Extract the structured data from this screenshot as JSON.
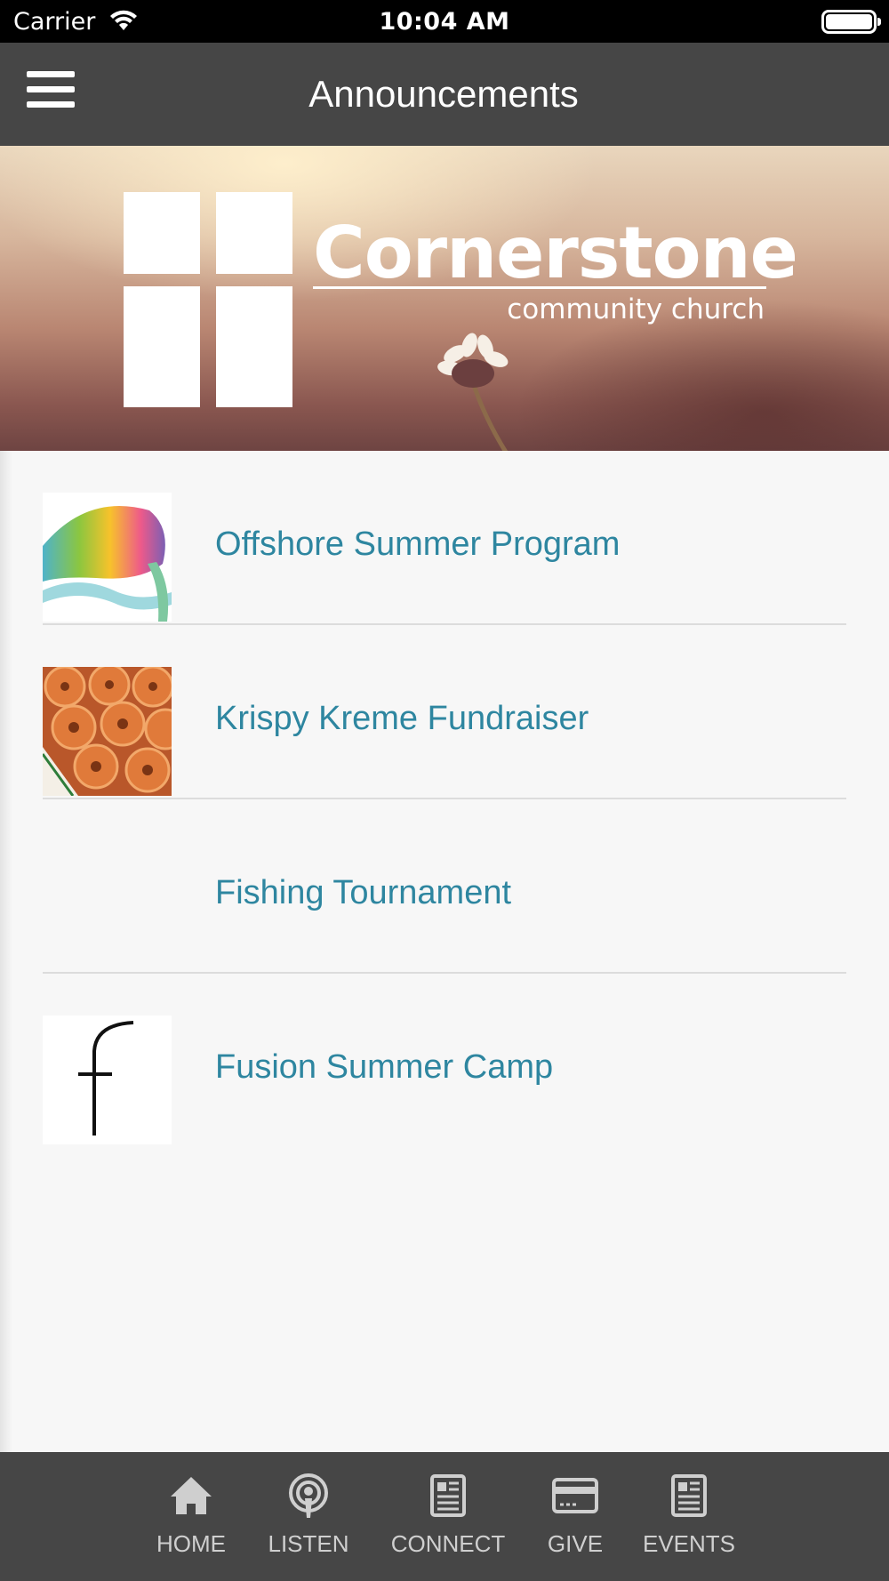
{
  "status_bar": {
    "carrier": "Carrier",
    "time": "10:04 AM"
  },
  "header": {
    "title": "Announcements",
    "menu_icon": "hamburger-menu-icon"
  },
  "banner": {
    "church_name": "Cornerstone",
    "church_subtitle": "community church",
    "logo_icon": "cross-logo-icon"
  },
  "announcements": [
    {
      "label": "Offshore Summer Program",
      "thumbnail": "offshore-fish-logo"
    },
    {
      "label": "Krispy Kreme Fundraiser",
      "thumbnail": "donuts-photo"
    },
    {
      "label": "Fishing Tournament",
      "thumbnail": ""
    },
    {
      "label": "Fusion Summer Camp",
      "thumbnail": "fusion-f-logo"
    }
  ],
  "tab_bar": {
    "tabs": [
      {
        "label": "HOME",
        "icon": "home-icon"
      },
      {
        "label": "LISTEN",
        "icon": "podcast-icon"
      },
      {
        "label": "CONNECT",
        "icon": "newspaper-icon"
      },
      {
        "label": "GIVE",
        "icon": "credit-card-icon"
      },
      {
        "label": "EVENTS",
        "icon": "newspaper-icon"
      }
    ]
  },
  "colors": {
    "bar_background": "#464646",
    "link_text": "#2e86a0",
    "tab_label": "#cfcfcf",
    "page_background": "#f7f7f7"
  }
}
